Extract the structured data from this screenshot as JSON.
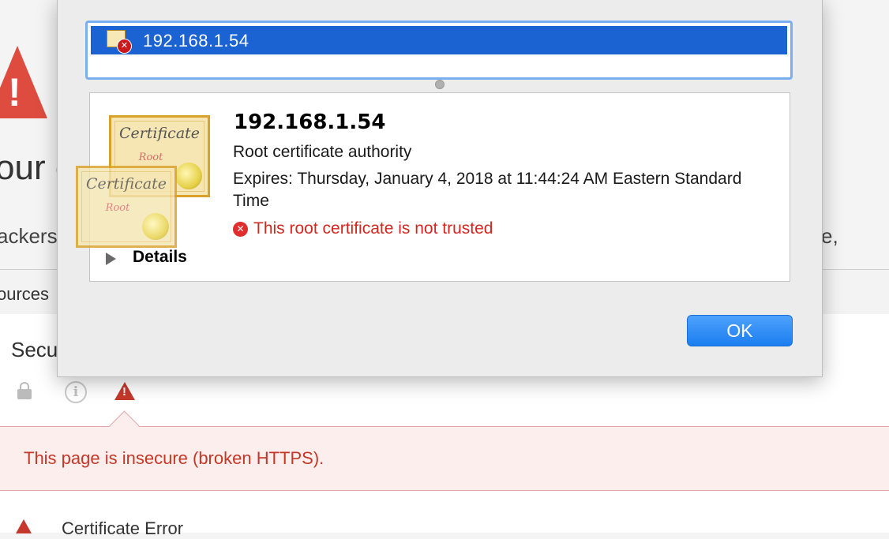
{
  "background_page": {
    "warning_glyph": "!",
    "headline_fragment": "our c",
    "paragraph_left_fragment": "ackers",
    "paragraph_right_fragment": "e,",
    "devtools_tab_fragment": "ources",
    "security_title_fragment": "Secu",
    "insecure_message": "This page is insecure (broken HTTPS).",
    "certificate_error_label": "Certificate Error",
    "status_colors": {
      "error": "#c53727",
      "banner_bg": "#fdeeee"
    }
  },
  "dialog": {
    "cert_list": {
      "selected_item": {
        "label": "192.168.1.54",
        "icon": "untrusted-certificate-icon"
      }
    },
    "details": {
      "name": "192.168.1.54",
      "type": "Root certificate authority",
      "expires": "Expires: Thursday, January 4, 2018 at 11:44:24 AM Eastern Standard Time",
      "status": "This root certificate is not trusted",
      "status_icon": "error-x-icon",
      "details_toggle": "Details",
      "cert_image_text": "Certificate",
      "cert_image_subtext": "Root"
    },
    "ok_button": "OK",
    "accent_color": "#1b62d3"
  }
}
